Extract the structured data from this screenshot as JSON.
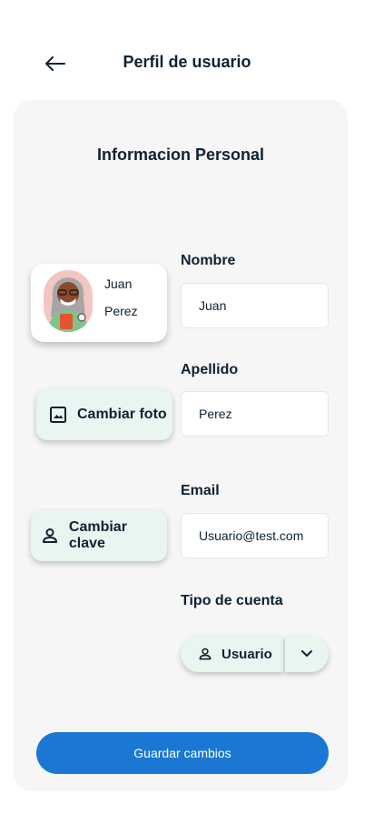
{
  "header": {
    "title": "Perfil de usuario",
    "back_icon": "arrow-left-icon"
  },
  "card": {
    "section_title": "Informacion Personal",
    "profile": {
      "first_name": "Juan",
      "last_name": "Perez",
      "avatar_icon": "user-avatar-illustration"
    },
    "buttons": {
      "change_photo": "Cambiar foto",
      "change_photo_icon": "image-icon",
      "change_password": "Cambiar clave",
      "change_password_icon": "person-icon"
    },
    "fields": {
      "nombre_label": "Nombre",
      "nombre_value": "Juan",
      "apellido_label": "Apellido",
      "apellido_value": "Perez",
      "email_label": "Email",
      "email_value": "Usuario@test.com",
      "tipo_label": "Tipo de cuenta",
      "tipo_value": "Usuario",
      "tipo_icon": "person-icon",
      "tipo_toggle_icon": "chevron-down-icon"
    },
    "save_label": "Guardar cambios"
  },
  "colors": {
    "primary": "#1a78d4",
    "accent_bg": "#e8f5f0",
    "text": "#0f2133",
    "card_bg": "#f6f6f6"
  }
}
